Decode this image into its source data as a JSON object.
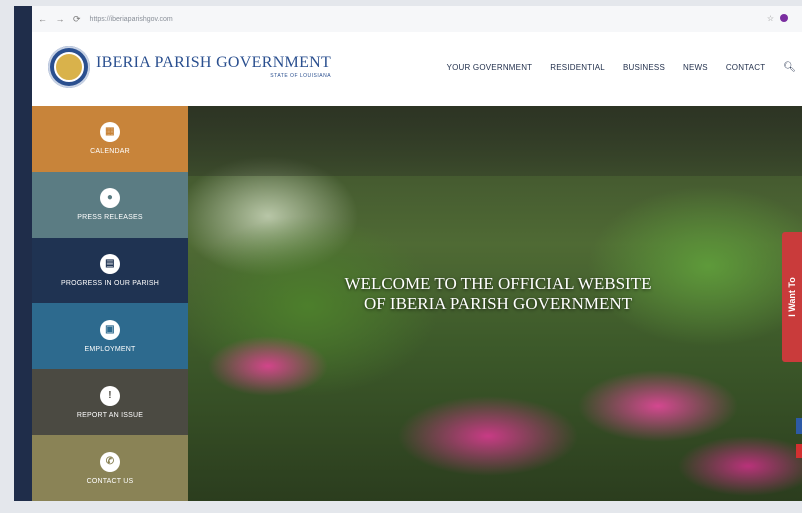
{
  "browser": {
    "url": "https://iberiaparishgov.com"
  },
  "header": {
    "title": "IBERIA PARISH GOVERNMENT",
    "subtitle": "STATE OF LOUISIANA",
    "nav": [
      "YOUR GOVERNMENT",
      "RESIDENTIAL",
      "BUSINESS",
      "NEWS",
      "CONTACT"
    ]
  },
  "sidebar": {
    "items": [
      {
        "label": "CALENDAR",
        "icon": "calendar-icon",
        "color": "#c8843a"
      },
      {
        "label": "PRESS RELEASES",
        "icon": "chat-icon",
        "color": "#5b7c83"
      },
      {
        "label": "PROGRESS IN OUR PARISH",
        "icon": "document-icon",
        "color": "#1f3352"
      },
      {
        "label": "EMPLOYMENT",
        "icon": "briefcase-icon",
        "color": "#2d6a8e"
      },
      {
        "label": "REPORT AN ISSUE",
        "icon": "exclamation-icon",
        "color": "#4b4a42"
      },
      {
        "label": "CONTACT US",
        "icon": "phone-icon",
        "color": "#8a8356"
      }
    ]
  },
  "hero": {
    "welcome": "WELCOME TO THE OFFICIAL WEBSITE OF IBERIA PARISH GOVERNMENT"
  },
  "side_tab": {
    "label": "I Want To"
  },
  "colors": {
    "brand": "#2a4f8f",
    "accent_red": "#c93b3b"
  }
}
